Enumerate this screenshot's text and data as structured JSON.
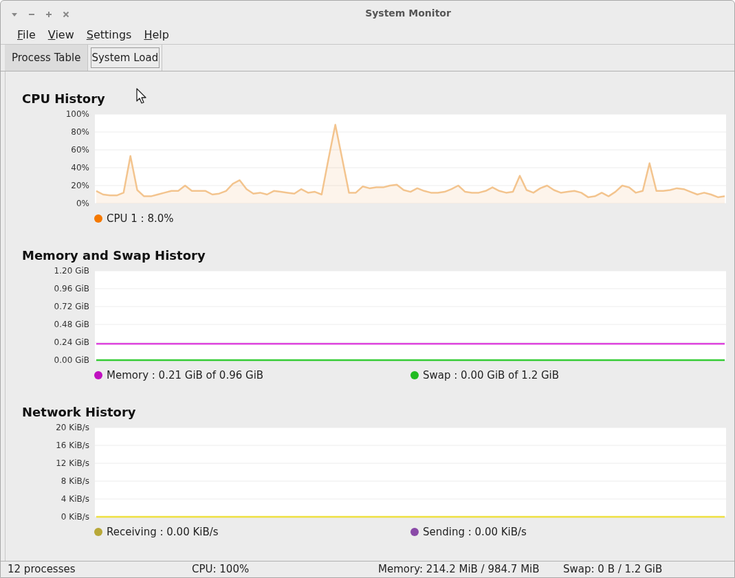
{
  "window": {
    "title": "System Monitor"
  },
  "menu": [
    "File",
    "View",
    "Settings",
    "Help"
  ],
  "tabs": [
    {
      "label": "Process Table",
      "selected": false
    },
    {
      "label": "System Load",
      "selected": true
    }
  ],
  "panels": [
    {
      "heading": "CPU History",
      "chart_data": {
        "type": "area",
        "grid": true,
        "ylim": [
          0,
          100
        ],
        "yticks": [
          {
            "value": 0,
            "label": "0%"
          },
          {
            "value": 20,
            "label": "20%"
          },
          {
            "value": 40,
            "label": "40%"
          },
          {
            "value": 60,
            "label": "60%"
          },
          {
            "value": 80,
            "label": "80%"
          },
          {
            "value": 100,
            "label": "100%"
          }
        ],
        "series": [
          {
            "color": "#f3c48e",
            "values": [
              14,
              10,
              9,
              9,
              12,
              53,
              15,
              8,
              8,
              10,
              12,
              14,
              14,
              20,
              14,
              14,
              14,
              10,
              11,
              14,
              22,
              26,
              16,
              11,
              12,
              10,
              14,
              13,
              12,
              11,
              16,
              12,
              13,
              10,
              50,
              88,
              50,
              12,
              12,
              19,
              17,
              18,
              18,
              20,
              21,
              15,
              13,
              17,
              14,
              12,
              12,
              13,
              16,
              20,
              13,
              12,
              12,
              14,
              18,
              14,
              12,
              13,
              31,
              15,
              12,
              17,
              20,
              15,
              12,
              13,
              14,
              12,
              7,
              8,
              12,
              8,
              13,
              20,
              18,
              12,
              14,
              45,
              14,
              14,
              15,
              17,
              16,
              13,
              10,
              12,
              10,
              7,
              8
            ]
          }
        ]
      },
      "legend": [
        {
          "text": "CPU 1 : 8.0%",
          "color": "#f57900"
        }
      ]
    },
    {
      "heading": "Memory and Swap History",
      "chart_data": {
        "type": "line",
        "grid": true,
        "ylim": [
          0,
          1.2
        ],
        "yticks": [
          {
            "value": 0,
            "label": "0.00 GiB"
          },
          {
            "value": 0.24,
            "label": "0.24 GiB"
          },
          {
            "value": 0.48,
            "label": "0.48 GiB"
          },
          {
            "value": 0.72,
            "label": "0.72 GiB"
          },
          {
            "value": 0.96,
            "label": "0.96 GiB"
          },
          {
            "value": 1.2,
            "label": "1.20 GiB"
          }
        ],
        "series": [
          {
            "color": "#dd44dd",
            "values": [
              0.22,
              0.22,
              0.22,
              0.22,
              0.22,
              0.22,
              0.22,
              0.22,
              0.22,
              0.22
            ]
          },
          {
            "color": "#33cc33",
            "values": [
              0,
              0,
              0,
              0,
              0,
              0,
              0,
              0,
              0,
              0
            ]
          }
        ]
      },
      "legend": [
        {
          "text": "Memory : 0.21 GiB of 0.96 GiB",
          "color": "#c010c0"
        },
        {
          "text": "Swap : 0.00 GiB of 1.2 GiB",
          "color": "#22bb22"
        }
      ]
    },
    {
      "heading": "Network History",
      "chart_data": {
        "type": "line",
        "grid": true,
        "ylim": [
          0,
          20
        ],
        "yticks": [
          {
            "value": 0,
            "label": "0 KiB/s"
          },
          {
            "value": 4,
            "label": "4 KiB/s"
          },
          {
            "value": 8,
            "label": "8 KiB/s"
          },
          {
            "value": 12,
            "label": "12 KiB/s"
          },
          {
            "value": 16,
            "label": "16 KiB/s"
          },
          {
            "value": 20,
            "label": "20 KiB/s"
          }
        ],
        "series": [
          {
            "color": "#eee040",
            "values": [
              0,
              0,
              0,
              0,
              0,
              0,
              0,
              0,
              0,
              0
            ]
          }
        ]
      },
      "legend": [
        {
          "text": "Receiving : 0.00 KiB/s",
          "color": "#b8a838"
        },
        {
          "text": "Sending : 0.00 KiB/s",
          "color": "#8a4aa8"
        }
      ]
    }
  ],
  "status_bar": [
    "12 processes",
    "CPU: 100%",
    "Memory: 214.2 MiB / 984.7 MiB",
    "Swap: 0 B / 1.2 GiB"
  ]
}
